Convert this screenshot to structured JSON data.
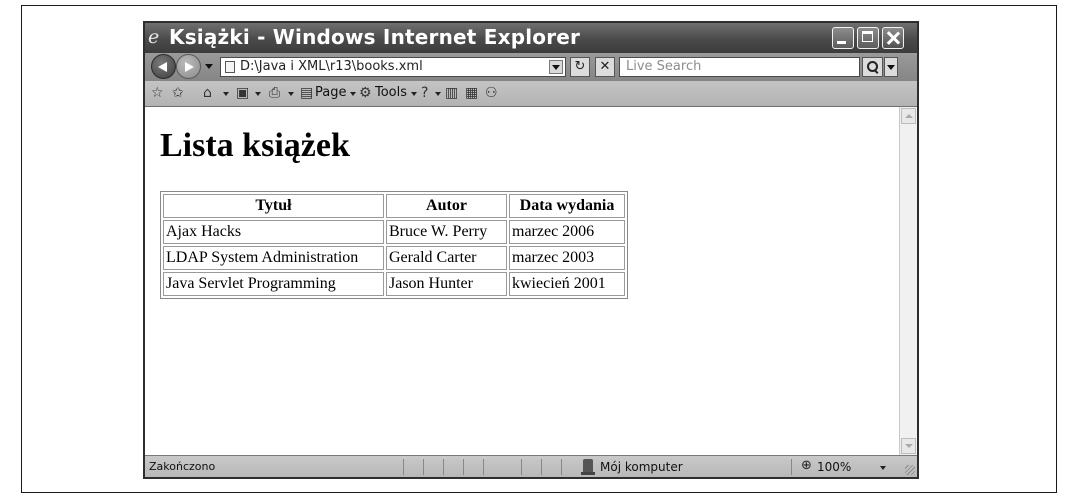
{
  "window": {
    "title": "Książki - Windows Internet Explorer",
    "title_icon": "ie-logo-icon"
  },
  "navigation": {
    "address": "D:\\Java i XML\\r13\\books.xml",
    "search_placeholder": "Live Search"
  },
  "command_bar": {
    "page_label": "Page",
    "tools_label": "Tools"
  },
  "page": {
    "heading": "Lista książek",
    "table": {
      "headers": [
        "Tytuł",
        "Autor",
        "Data wydania"
      ],
      "rows": [
        [
          "Ajax Hacks",
          "Bruce W. Perry",
          "marzec 2006"
        ],
        [
          "LDAP System Administration",
          "Gerald Carter",
          "marzec 2003"
        ],
        [
          "Java Servlet Programming",
          "Jason Hunter",
          "kwiecień 2001"
        ]
      ]
    }
  },
  "status_bar": {
    "status": "Zakończono",
    "zone": "Mój komputer",
    "zoom": "100%"
  }
}
